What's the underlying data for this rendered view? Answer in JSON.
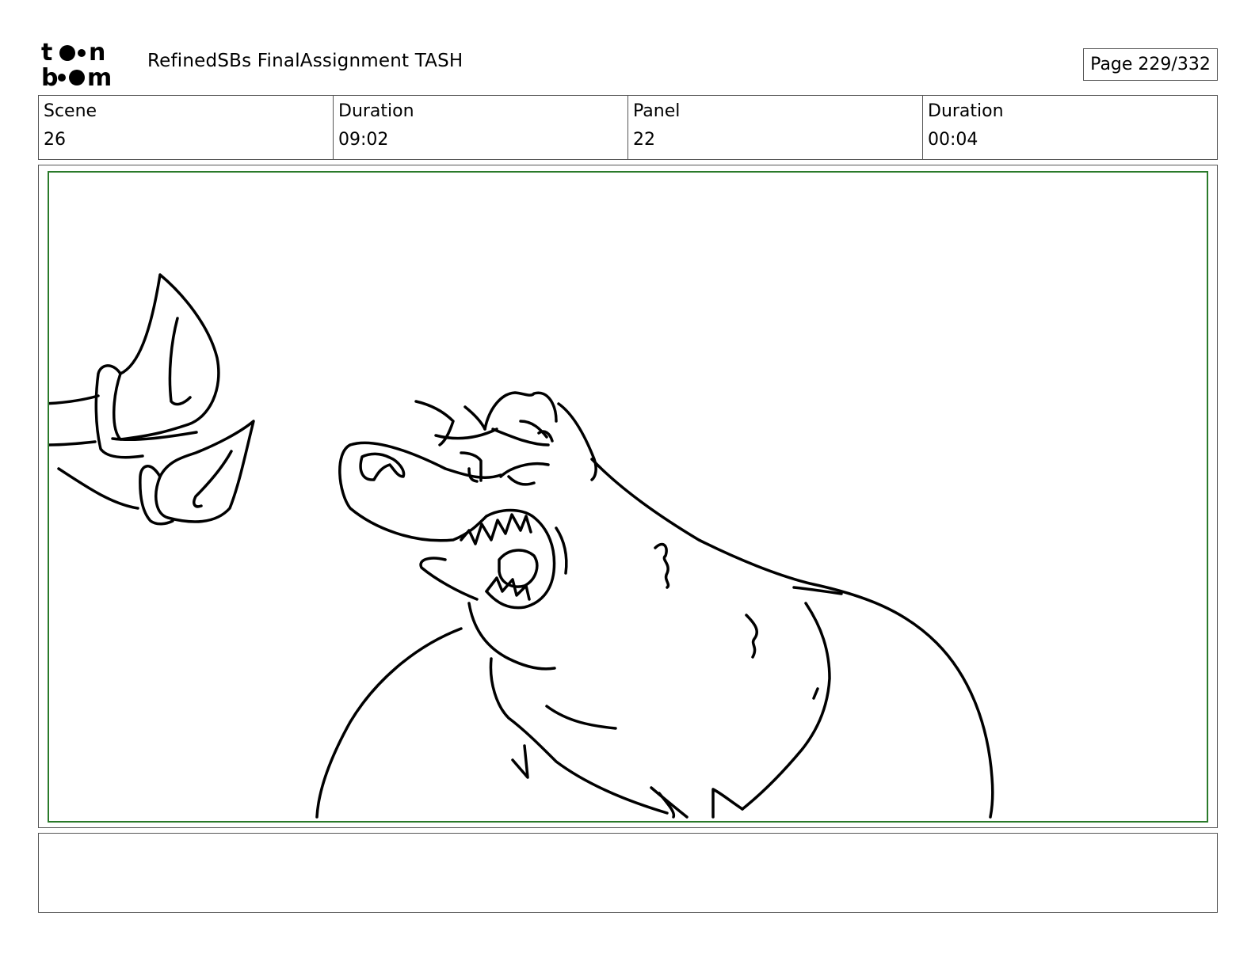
{
  "header": {
    "logo_text": "toonboom",
    "title": "RefinedSBs FinalAssignment TASH",
    "page": "Page 229/332"
  },
  "info": {
    "scene_label": "Scene",
    "scene_value": "26",
    "scene_duration_label": "Duration",
    "scene_duration_value": "09:02",
    "panel_label": "Panel",
    "panel_value": "22",
    "panel_duration_label": "Duration",
    "panel_duration_value": "00:04"
  },
  "notes": {
    "text": ""
  },
  "colors": {
    "safe_frame": "#2a7a2a",
    "border": "#555555",
    "ink": "#000000"
  }
}
